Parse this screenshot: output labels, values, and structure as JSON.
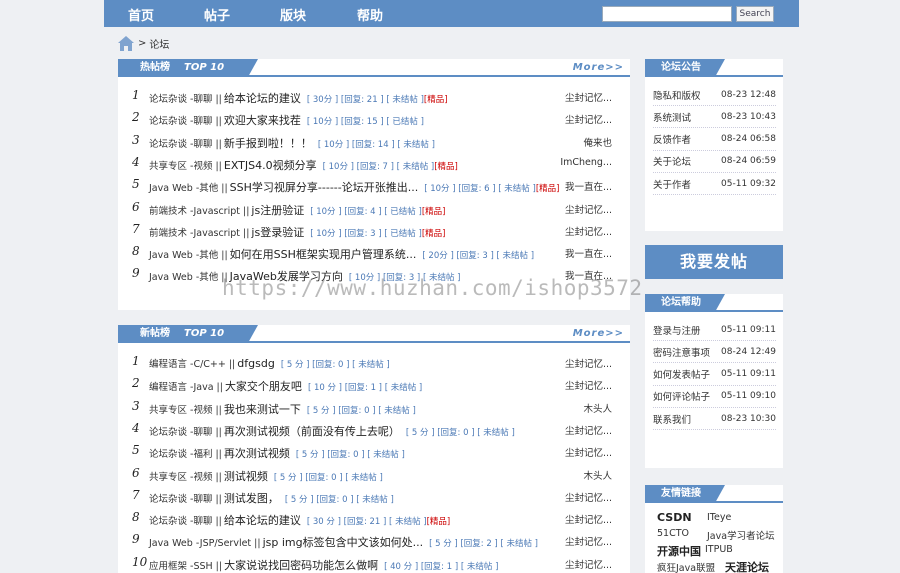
{
  "nav": {
    "items": [
      "首页",
      "帖子",
      "版块",
      "帮助"
    ],
    "search_placeholder": "",
    "search_label": "Search"
  },
  "breadcrumb": {
    "sep": ">",
    "current": "论坛"
  },
  "hot": {
    "title": "热帖榜",
    "top_label": "TOP 10",
    "more": "More>>",
    "rows": [
      {
        "rank": "1",
        "cat": "论坛杂谈 -聊聊 ||",
        "title": "给本论坛的建议",
        "meta": "[ 30分 ] [回复: 21 ] [ 未结帖 ]",
        "jing": "[精品]",
        "author": "尘封记忆..."
      },
      {
        "rank": "2",
        "cat": "论坛杂谈 -聊聊 ||",
        "title": "欢迎大家来找茬",
        "meta": "[ 10分 ] [回复: 15 ] [ 已结帖 ]",
        "jing": "",
        "author": "尘封记忆..."
      },
      {
        "rank": "3",
        "cat": "论坛杂谈 -聊聊 ||",
        "title": "新手报到啦！！！",
        "meta": "[ 10分 ] [回复: 14 ] [ 未结帖 ]",
        "jing": "",
        "author": "俺来也"
      },
      {
        "rank": "4",
        "cat": "共享专区 -视频 ||",
        "title": "EXTJS4.0视频分享",
        "meta": "[ 10分 ] [回复: 7 ] [ 未结帖 ]",
        "jing": "[精品]",
        "author": "ImCheng..."
      },
      {
        "rank": "5",
        "cat": "Java Web -其他 ||",
        "title": "SSH学习视屏分享------论坛开张推出...",
        "meta": "[ 10分 ] [回复: 6 ] [ 未结帖 ]",
        "jing": "[精品]",
        "author": "我一直在..."
      },
      {
        "rank": "6",
        "cat": "前端技术 -Javascript ||",
        "title": "js注册验证",
        "meta": "[ 10分 ] [回复: 4 ] [ 已结帖 ]",
        "jing": "[精品]",
        "author": "尘封记忆..."
      },
      {
        "rank": "7",
        "cat": "前端技术 -Javascript ||",
        "title": "js登录验证",
        "meta": "[ 10分 ] [回复: 3 ] [ 已结帖 ]",
        "jing": "[精品]",
        "author": "尘封记忆..."
      },
      {
        "rank": "8",
        "cat": "Java Web -其他 ||",
        "title": "如何在用SSH框架实现用户管理系统...",
        "meta": "[ 20分 ] [回复: 3 ] [ 未结帖 ]",
        "jing": "",
        "author": "我一直在..."
      },
      {
        "rank": "9",
        "cat": "Java Web -其他 ||",
        "title": "JavaWeb发展学习方向",
        "meta": "[ 10分 ] [回复: 3 ] [ 未结帖 ]",
        "jing": "",
        "author": "我一直在..."
      }
    ]
  },
  "latest": {
    "title": "新帖榜",
    "top_label": "TOP 10",
    "more": "More>>",
    "rows": [
      {
        "rank": "1",
        "cat": "编程语言 -C/C++ ||",
        "title": "dfgsdg",
        "meta": "[ 5 分 ] [回复: 0 ] [ 未结帖 ]",
        "jing": "",
        "author": "尘封记忆..."
      },
      {
        "rank": "2",
        "cat": "编程语言 -Java ||",
        "title": "大家交个朋友吧",
        "meta": "[ 10 分 ] [回复: 1 ] [ 未结帖 ]",
        "jing": "",
        "author": "尘封记忆..."
      },
      {
        "rank": "3",
        "cat": "共享专区 -视频 ||",
        "title": "我也来测试一下",
        "meta": "[ 5 分 ] [回复: 0 ] [ 未结帖 ]",
        "jing": "",
        "author": "木头人"
      },
      {
        "rank": "4",
        "cat": "论坛杂谈 -聊聊 ||",
        "title": "再次测试视频（前面没有传上去呢）",
        "meta": "[ 5 分 ] [回复: 0 ] [ 未结帖 ]",
        "jing": "",
        "author": "尘封记忆..."
      },
      {
        "rank": "5",
        "cat": "论坛杂谈 -福利 ||",
        "title": "再次测试视频",
        "meta": "[ 5 分 ] [回复: 0 ] [ 未结帖 ]",
        "jing": "",
        "author": "尘封记忆..."
      },
      {
        "rank": "6",
        "cat": "共享专区 -视频 ||",
        "title": "测试视频",
        "meta": "[ 5 分 ] [回复: 0 ] [ 未结帖 ]",
        "jing": "",
        "author": "木头人"
      },
      {
        "rank": "7",
        "cat": "论坛杂谈 -聊聊 ||",
        "title": "测试发图，",
        "meta": "[ 5 分 ] [回复: 0 ] [ 未结帖 ]",
        "jing": "",
        "author": "尘封记忆..."
      },
      {
        "rank": "8",
        "cat": "论坛杂谈 -聊聊 ||",
        "title": "给本论坛的建议",
        "meta": "[ 30 分 ] [回复: 21 ] [ 未结帖 ]",
        "jing": "[精品]",
        "author": "尘封记忆..."
      },
      {
        "rank": "9",
        "cat": "Java Web -JSP/Servlet ||",
        "title": "jsp img标签包含中文该如何处...",
        "meta": "[ 5 分 ] [回复: 2 ] [ 未结帖 ]",
        "jing": "",
        "author": "尘封记忆..."
      },
      {
        "rank": "10",
        "cat": "应用框架 -SSH ||",
        "title": "大家说说找回密码功能怎么做啊",
        "meta": "[ 40 分 ] [回复: 1 ] [ 未结帖 ]",
        "jing": "",
        "author": "尘封记忆..."
      }
    ]
  },
  "notice": {
    "title": "论坛公告",
    "rows": [
      {
        "label": "隐私和版权",
        "date": "08-23 12:48"
      },
      {
        "label": "系统测试",
        "date": "08-23 10:43"
      },
      {
        "label": "反馈作者",
        "date": "08-24 06:58"
      },
      {
        "label": "关于论坛",
        "date": "08-24 06:59"
      },
      {
        "label": "关于作者",
        "date": "05-11 09:32"
      }
    ]
  },
  "post_button": "我要发帖",
  "help": {
    "title": "论坛帮助",
    "rows": [
      {
        "label": "登录与注册",
        "date": "05-11 09:11"
      },
      {
        "label": "密码注意事项",
        "date": "08-24 12:49"
      },
      {
        "label": "如何发表帖子",
        "date": "05-11 09:11"
      },
      {
        "label": "如何评论帖子",
        "date": "05-11 09:10"
      },
      {
        "label": "联系我们",
        "date": "08-23 10:30"
      }
    ]
  },
  "links": {
    "title": "友情链接",
    "items": [
      "CSDN",
      "ITeye",
      "51CTO",
      "Java学习者论坛",
      "开源中国",
      "ITPUB",
      "疯狂Java联盟",
      "天涯论坛"
    ]
  },
  "watermark": "https://www.huzhan.com/ishop3572",
  "colors": {
    "accent": "#5d8dc4",
    "jing": "#cc0000",
    "meta": "#4a78b5"
  }
}
